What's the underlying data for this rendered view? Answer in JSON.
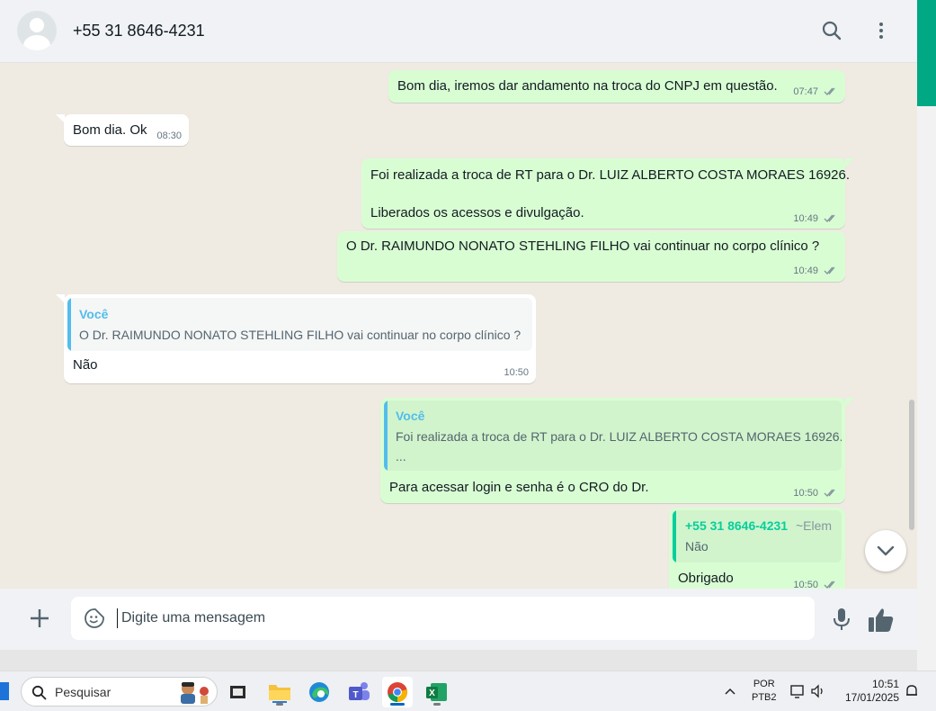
{
  "header": {
    "contact_name": "+55 31 8646-4231"
  },
  "messages": [
    {
      "text": "Bom dia, iremos dar andamento na troca do CNPJ em questão.",
      "time": "07:47"
    },
    {
      "text": "Bom dia. Ok",
      "time": "08:30"
    },
    {
      "line1": "Foi realizada a troca de RT para o Dr. LUIZ ALBERTO COSTA MORAES 16926.",
      "line2": "Liberados os acessos e divulgação.",
      "time": "10:49"
    },
    {
      "text": "O Dr. RAIMUNDO NONATO STEHLING FILHO vai continuar no corpo clínico ?",
      "time": "10:49"
    },
    {
      "quote_author": "Você",
      "quote_text": "O Dr. RAIMUNDO NONATO STEHLING FILHO vai continuar no corpo clínico ?",
      "text": "Não",
      "time": "10:50"
    },
    {
      "quote_author": "Você",
      "quote_text": "Foi realizada a troca de RT para o Dr. LUIZ ALBERTO COSTA MORAES 16926.",
      "quote_more": "...",
      "text": "Para acessar login e senha é o CRO do Dr.",
      "time": "10:50"
    },
    {
      "quote_author": "+55 31 8646-4231",
      "quote_alias": "~Elem",
      "quote_text": "Não",
      "text": "Obrigado",
      "time": "10:50"
    }
  ],
  "composer": {
    "placeholder": "Digite uma mensagem"
  },
  "taskbar": {
    "search_label": "Pesquisar",
    "lang_line1": "POR",
    "lang_line2": "PTB2",
    "time": "10:51",
    "date": "17/01/2025"
  },
  "colors": {
    "outgoing_bubble": "#d9fdd3",
    "incoming_bubble": "#ffffff",
    "quote_self_accent": "#53bdeb",
    "quote_other_accent": "#06cf9c",
    "brand_green": "#00a884",
    "chat_background": "#efeae2"
  }
}
